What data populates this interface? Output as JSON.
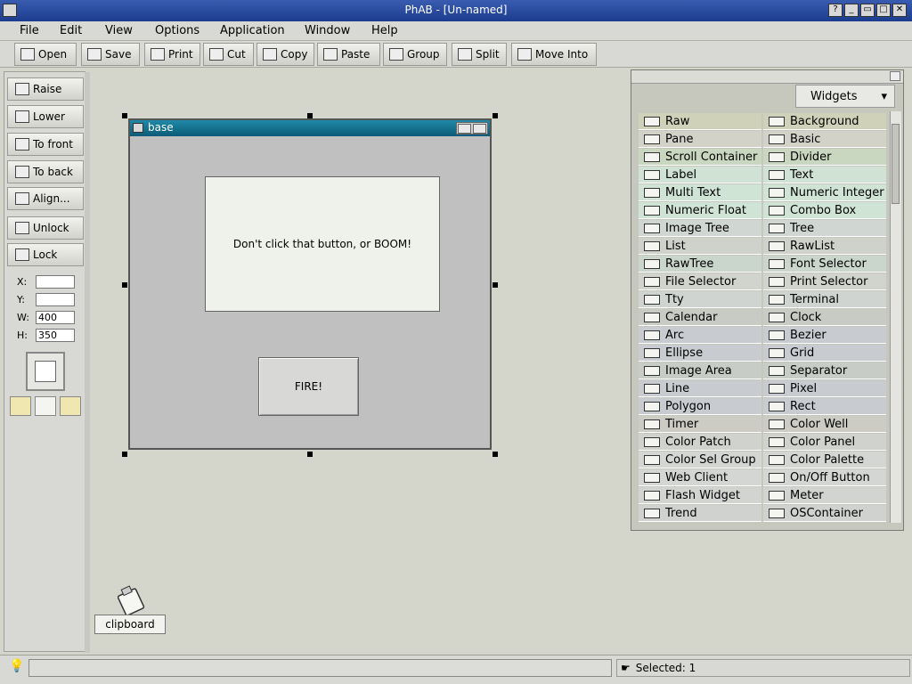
{
  "window": {
    "title": "PhAB - [Un-named]"
  },
  "menu": [
    "File",
    "Edit",
    "View",
    "Options",
    "Application",
    "Window",
    "Help"
  ],
  "toolbar": [
    "Open",
    "Save",
    "Print",
    "Cut",
    "Copy",
    "Paste",
    "Group",
    "Split",
    "Move Into"
  ],
  "left_panel": {
    "buttons": [
      "Raise",
      "Lower",
      "To front",
      "To back",
      "Align..."
    ],
    "lock_buttons": [
      "Unlock",
      "Lock"
    ],
    "fields": {
      "x_label": "X:",
      "y_label": "Y:",
      "w_label": "W:",
      "h_label": "H:",
      "x": "",
      "y": "",
      "w": "400",
      "h": "350"
    }
  },
  "base_window": {
    "title": "base",
    "message": "Don't click that button, or BOOM!",
    "button_label": "FIRE!"
  },
  "widgets_panel": {
    "tab_label": "Widgets",
    "items": [
      [
        "Raw",
        "Background"
      ],
      [
        "Pane",
        "Basic"
      ],
      [
        "Scroll Container",
        "Divider"
      ],
      [
        "Label",
        "Text"
      ],
      [
        "Multi Text",
        "Numeric Integer"
      ],
      [
        "Numeric Float",
        "Combo Box"
      ],
      [
        "Image Tree",
        "Tree"
      ],
      [
        "List",
        "RawList"
      ],
      [
        "RawTree",
        "Font Selector"
      ],
      [
        "File Selector",
        "Print Selector"
      ],
      [
        "Tty",
        "Terminal"
      ],
      [
        "Calendar",
        "Clock"
      ],
      [
        "Arc",
        "Bezier"
      ],
      [
        "Ellipse",
        "Grid"
      ],
      [
        "Image Area",
        "Separator"
      ],
      [
        "Line",
        "Pixel"
      ],
      [
        "Polygon",
        "Rect"
      ],
      [
        "Timer",
        "Color Well"
      ],
      [
        "Color Patch",
        "Color Panel"
      ],
      [
        "Color Sel Group",
        "Color Palette"
      ],
      [
        "Web Client",
        "On/Off Button"
      ],
      [
        "Flash Widget",
        "Meter"
      ],
      [
        "Trend",
        "OSContainer"
      ]
    ],
    "row_colors": [
      "#cfd2b8",
      "#d2d2c8",
      "#cad7c0",
      "#cfe2d4",
      "#d0e4d6",
      "#d0e4d6",
      "#d0d6d2",
      "#ced2ca",
      "#cad6cc",
      "#d0d4cc",
      "#d0d4d0",
      "#c8cac4",
      "#c8ccd0",
      "#c8ccd0",
      "#c8ccc6",
      "#c8ccd0",
      "#c8ccd0",
      "#ccccc4",
      "#d0d2ce",
      "#d4d6d4",
      "#d4d6d4",
      "#d2d4d2",
      "#d0d2d0"
    ]
  },
  "clipboard": {
    "label": "clipboard"
  },
  "status": {
    "message": "",
    "selected": "Selected: 1"
  }
}
